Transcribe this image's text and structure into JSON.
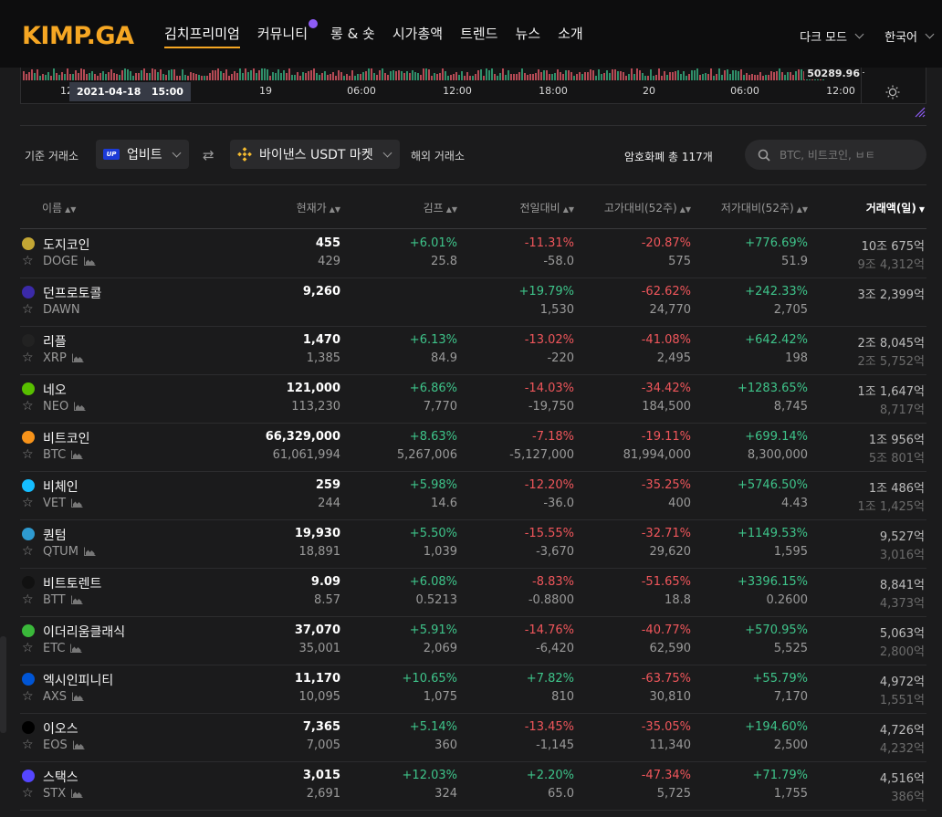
{
  "nav": {
    "logo": "KIMP.GA",
    "menu": [
      "김치프리미엄",
      "커뮤니티",
      "롱 & 숏",
      "시가총액",
      "트렌드",
      "뉴스",
      "소개"
    ],
    "theme": "다크 모드",
    "language": "한국어"
  },
  "chart_strip": {
    "last_price": "50289.96",
    "crosshair_date": "2021-04-18",
    "crosshair_time": "15:00",
    "ticks": [
      "12",
      "00",
      "19",
      "06:00",
      "12:00",
      "18:00",
      "20",
      "06:00",
      "12:00"
    ]
  },
  "toolbar": {
    "base_label": "기준 거래소",
    "base_exchange": "업비트",
    "foreign_exchange": "바이낸스 USDT 마켓",
    "foreign_label": "해외 거래소",
    "total": "암호화폐 총 117개",
    "search_placeholder": "BTC, 비트코인, ㅂㅌ"
  },
  "table": {
    "headers": [
      "이름",
      "현재가",
      "김프",
      "전일대비",
      "고가대비(52주)",
      "저가대비(52주)",
      "거래액(일)"
    ],
    "rows": [
      {
        "icon": "dogecoin-icon",
        "color": "#c3a634",
        "name": "도지코인",
        "sym": "DOGE",
        "price": "455",
        "price2": "429",
        "kimp": "+6.01%",
        "kimp2": "25.8",
        "day": "-11.31%",
        "day2": "-58.0",
        "high": "-20.87%",
        "high2": "575",
        "low": "+776.69%",
        "low2": "51.9",
        "vol": "10조 675억",
        "vol2": "9조 4,312억",
        "chart": true
      },
      {
        "icon": "dawn-icon",
        "color": "#3b2aa8",
        "name": "던프로토콜",
        "sym": "DAWN",
        "price": "9,260",
        "price2": "",
        "kimp": "",
        "kimp2": "",
        "day": "+19.79%",
        "day2": "1,530",
        "high": "-62.62%",
        "high2": "24,770",
        "low": "+242.33%",
        "low2": "2,705",
        "vol": "3조 2,399억",
        "vol2": "",
        "chart": false
      },
      {
        "icon": "ripple-icon",
        "color": "#222222",
        "name": "리플",
        "sym": "XRP",
        "price": "1,470",
        "price2": "1,385",
        "kimp": "+6.13%",
        "kimp2": "84.9",
        "day": "-13.02%",
        "day2": "-220",
        "high": "-41.08%",
        "high2": "2,495",
        "low": "+642.42%",
        "low2": "198",
        "vol": "2조 8,045억",
        "vol2": "2조 5,752억",
        "chart": true
      },
      {
        "icon": "neo-icon",
        "color": "#58bf00",
        "name": "네오",
        "sym": "NEO",
        "price": "121,000",
        "price2": "113,230",
        "kimp": "+6.86%",
        "kimp2": "7,770",
        "day": "-14.03%",
        "day2": "-19,750",
        "high": "-34.42%",
        "high2": "184,500",
        "low": "+1283.65%",
        "low2": "8,745",
        "vol": "1조 1,647억",
        "vol2": "8,717억",
        "chart": true
      },
      {
        "icon": "bitcoin-icon",
        "color": "#f7931a",
        "name": "비트코인",
        "sym": "BTC",
        "price": "66,329,000",
        "price2": "61,061,994",
        "kimp": "+8.63%",
        "kimp2": "5,267,006",
        "day": "-7.18%",
        "day2": "-5,127,000",
        "high": "-19.11%",
        "high2": "81,994,000",
        "low": "+699.14%",
        "low2": "8,300,000",
        "vol": "1조 956억",
        "vol2": "5조 801억",
        "chart": true
      },
      {
        "icon": "vechain-icon",
        "color": "#15bdff",
        "name": "비체인",
        "sym": "VET",
        "price": "259",
        "price2": "244",
        "kimp": "+5.98%",
        "kimp2": "14.6",
        "day": "-12.20%",
        "day2": "-36.0",
        "high": "-35.25%",
        "high2": "400",
        "low": "+5746.50%",
        "low2": "4.43",
        "vol": "1조 486억",
        "vol2": "1조 1,425억",
        "chart": true
      },
      {
        "icon": "qtum-icon",
        "color": "#2e9ad0",
        "name": "퀀텀",
        "sym": "QTUM",
        "price": "19,930",
        "price2": "18,891",
        "kimp": "+5.50%",
        "kimp2": "1,039",
        "day": "-15.55%",
        "day2": "-3,670",
        "high": "-32.71%",
        "high2": "29,620",
        "low": "+1149.53%",
        "low2": "1,595",
        "vol": "9,527억",
        "vol2": "3,016억",
        "chart": true
      },
      {
        "icon": "bittorrent-icon",
        "color": "#111111",
        "name": "비트토렌트",
        "sym": "BTT",
        "price": "9.09",
        "price2": "8.57",
        "kimp": "+6.08%",
        "kimp2": "0.5213",
        "day": "-8.83%",
        "day2": "-0.8800",
        "high": "-51.65%",
        "high2": "18.8",
        "low": "+3396.15%",
        "low2": "0.2600",
        "vol": "8,841억",
        "vol2": "4,373억",
        "chart": true
      },
      {
        "icon": "ethereum-classic-icon",
        "color": "#3ab83a",
        "name": "이더리움클래식",
        "sym": "ETC",
        "price": "37,070",
        "price2": "35,001",
        "kimp": "+5.91%",
        "kimp2": "2,069",
        "day": "-14.76%",
        "day2": "-6,420",
        "high": "-40.77%",
        "high2": "62,590",
        "low": "+570.95%",
        "low2": "5,525",
        "vol": "5,063억",
        "vol2": "2,800억",
        "chart": true
      },
      {
        "icon": "axie-icon",
        "color": "#0055d5",
        "name": "엑시인피니티",
        "sym": "AXS",
        "price": "11,170",
        "price2": "10,095",
        "kimp": "+10.65%",
        "kimp2": "1,075",
        "day": "+7.82%",
        "day2": "810",
        "high": "-63.75%",
        "high2": "30,810",
        "low": "+55.79%",
        "low2": "7,170",
        "vol": "4,972억",
        "vol2": "1,551억",
        "chart": true
      },
      {
        "icon": "eos-icon",
        "color": "#000000",
        "name": "이오스",
        "sym": "EOS",
        "price": "7,365",
        "price2": "7,005",
        "kimp": "+5.14%",
        "kimp2": "360",
        "day": "-13.45%",
        "day2": "-1,145",
        "high": "-35.05%",
        "high2": "11,340",
        "low": "+194.60%",
        "low2": "2,500",
        "vol": "4,726억",
        "vol2": "4,232억",
        "chart": true
      },
      {
        "icon": "stacks-icon",
        "color": "#5546ff",
        "name": "스택스",
        "sym": "STX",
        "price": "3,015",
        "price2": "2,691",
        "kimp": "+12.03%",
        "kimp2": "324",
        "day": "+2.20%",
        "day2": "65.0",
        "high": "-47.34%",
        "high2": "5,725",
        "low": "+71.79%",
        "low2": "1,755",
        "vol": "4,516억",
        "vol2": "386억",
        "chart": true
      }
    ]
  },
  "colors": {
    "accent": "#f5a623",
    "positive": "#3ec48a",
    "negative": "#f0565b",
    "background": "#1b1b1c"
  }
}
